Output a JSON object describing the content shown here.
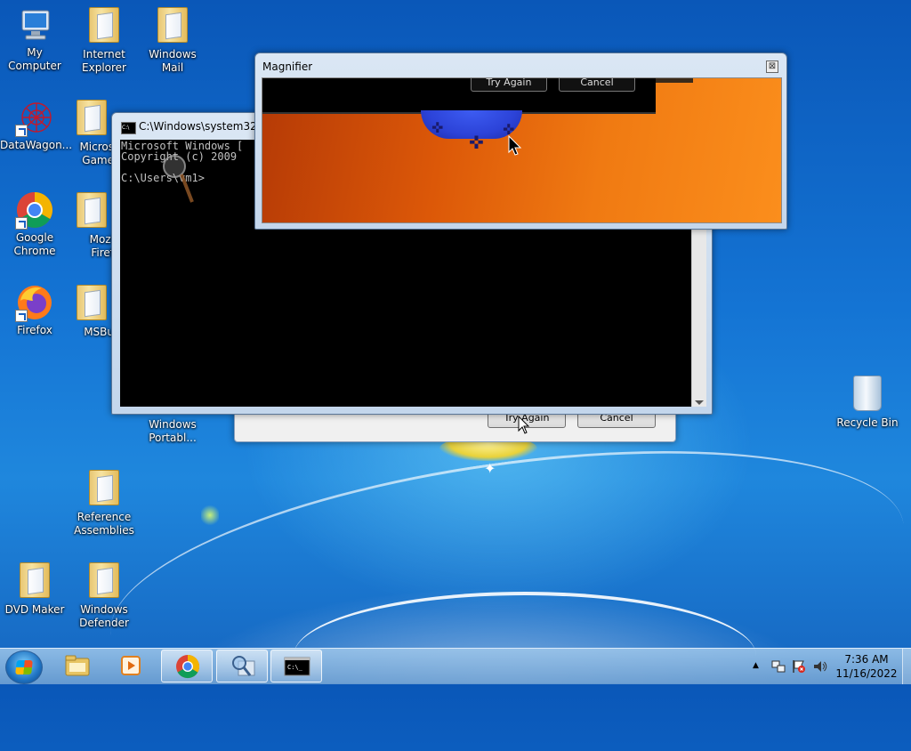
{
  "desktop_icons": [
    {
      "id": "my-computer",
      "label": "My Computer"
    },
    {
      "id": "internet-explorer",
      "label": "Internet\nExplorer"
    },
    {
      "id": "windows-mail",
      "label": "Windows\nMail"
    },
    {
      "id": "datawagon",
      "label": "DataWagon..."
    },
    {
      "id": "microsoft-games",
      "label": "Micros\nGame"
    },
    {
      "id": "google-chrome",
      "label": "Google\nChrome"
    },
    {
      "id": "mozilla-firefox",
      "label": "Mozi\nFiref"
    },
    {
      "id": "firefox",
      "label": "Firefox"
    },
    {
      "id": "msbuild",
      "label": "MSBu"
    },
    {
      "id": "windows-portable",
      "label": "Windows\nPortabl..."
    },
    {
      "id": "reference-assemblies",
      "label": "Reference\nAssemblies"
    },
    {
      "id": "dvd-maker",
      "label": "DVD Maker"
    },
    {
      "id": "windows-defender",
      "label": "Windows\nDefender"
    },
    {
      "id": "recycle-bin",
      "label": "Recycle Bin"
    }
  ],
  "dialog": {
    "try_again_label": "Try Again",
    "cancel_label": "Cancel"
  },
  "cmd_window": {
    "title": "C:\\Windows\\system32\\c",
    "icon_text": "C:\\",
    "console_text": "Microsoft Windows [\nCopyright (c) 2009\n\nC:\\Users\\vm1>"
  },
  "magnifier": {
    "title": "Magnifier",
    "close_glyph": "⊠",
    "try_again_label": "Try Again",
    "cancel_label": "Cancel"
  },
  "taskbar": {
    "items": [
      {
        "id": "explorer",
        "active": false
      },
      {
        "id": "media-player",
        "active": false
      },
      {
        "id": "chrome",
        "active": true
      },
      {
        "id": "magnifier",
        "active": true
      },
      {
        "id": "cmd",
        "active": true
      }
    ],
    "tray_arrow": "▲",
    "time": "7:36 AM",
    "date": "11/16/2022"
  },
  "colors": {
    "desktop_top": "#0a57b8",
    "desktop_bottom": "#1565c0",
    "magnifier_orange": "#f07a12",
    "blob_blue": "#2c43d8"
  }
}
